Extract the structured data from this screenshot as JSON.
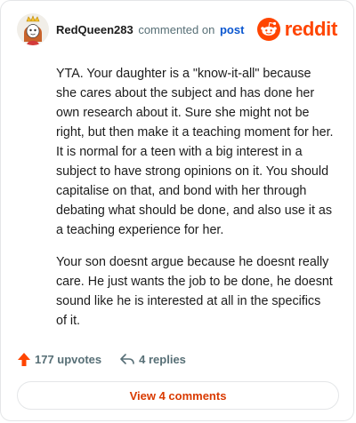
{
  "header": {
    "username": "RedQueen283",
    "verb": "commented on",
    "link": "post",
    "brand": "reddit"
  },
  "comment": {
    "paragraphs": [
      "YTA. Your daughter is a \"know-it-all\" because she cares about the subject and has done her own research about it. Sure she might not be right, but then make it a teaching moment for her. It is normal for a teen with a big interest in a subject to have strong opinions on it. You should capitalise on that, and bond with her through debating what should be done, and also use it as a teaching experience for her.",
      "Your son doesnt argue because he doesnt really care. He just wants the job to be done, he doesnt sound like he is interested at all in the specifics of it."
    ]
  },
  "stats": {
    "upvotes": "177 upvotes",
    "replies": "4 replies"
  },
  "footer": {
    "view_comments": "View 4 comments"
  },
  "colors": {
    "brand": "#ff4500",
    "upvote": "#ff4500",
    "link": "#0b57d0",
    "view_button_text": "#d93a00"
  },
  "icons": {
    "avatar": "snoo-avatar-icon",
    "brand": "reddit-logo-icon",
    "upvote": "upvote-arrow-icon",
    "reply": "reply-arrow-icon"
  }
}
